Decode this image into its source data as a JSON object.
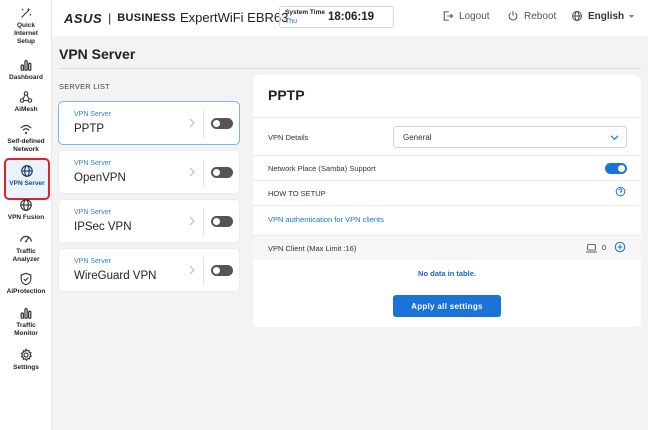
{
  "brand": {
    "logo": "ASUS",
    "separator": "|",
    "product_line": "BUSINESS",
    "model": "ExpertWiFi EBR63"
  },
  "header": {
    "system_time_label": "System Time",
    "system_time_day": "Thu",
    "system_time_clock": "18:06:19",
    "logout_label": "Logout",
    "reboot_label": "Reboot",
    "language_label": "English"
  },
  "sidebar": {
    "items": [
      {
        "label": "Quick Internet Setup",
        "icon": "wizard-icon"
      },
      {
        "label": "Dashboard",
        "icon": "dashboard-icon"
      },
      {
        "label": "AiMesh",
        "icon": "aimesh-icon"
      },
      {
        "label": "Self-defined Network",
        "icon": "network-icon"
      },
      {
        "label": "VPN Server",
        "icon": "vpn-server-icon",
        "active": true
      },
      {
        "label": "VPN Fusion",
        "icon": "vpn-fusion-icon"
      },
      {
        "label": "Traffic Analyzer",
        "icon": "traffic-analyzer-icon"
      },
      {
        "label": "AiProtection",
        "icon": "shield-icon"
      },
      {
        "label": "Traffic Monitor",
        "icon": "traffic-monitor-icon"
      },
      {
        "label": "Settings",
        "icon": "gear-icon"
      }
    ]
  },
  "page": {
    "title": "VPN Server"
  },
  "server_list": {
    "heading": "SERVER LIST",
    "items": [
      {
        "category": "VPN Server",
        "name": "PPTP",
        "enabled": false,
        "selected": true
      },
      {
        "category": "VPN Server",
        "name": "OpenVPN",
        "enabled": false
      },
      {
        "category": "VPN Server",
        "name": "IPSec VPN",
        "enabled": false
      },
      {
        "category": "VPN Server",
        "name": "WireGuard VPN",
        "enabled": false
      }
    ]
  },
  "detail": {
    "title": "PPTP",
    "vpn_details_label": "VPN Details",
    "vpn_details_value": "General",
    "samba_label": "Network Place (Samba) Support",
    "samba_enabled": true,
    "how_to_setup_label": "HOW TO SETUP",
    "auth_link": "VPN authentication for VPN clients",
    "client_label": "VPN Client (Max Limit :16)",
    "client_count": "0",
    "no_data": "No data in table.",
    "apply_label": "Apply all settings"
  },
  "colors": {
    "accent": "#1a73d9",
    "highlight_border": "#e0202a",
    "toggle_off": "#555555"
  }
}
